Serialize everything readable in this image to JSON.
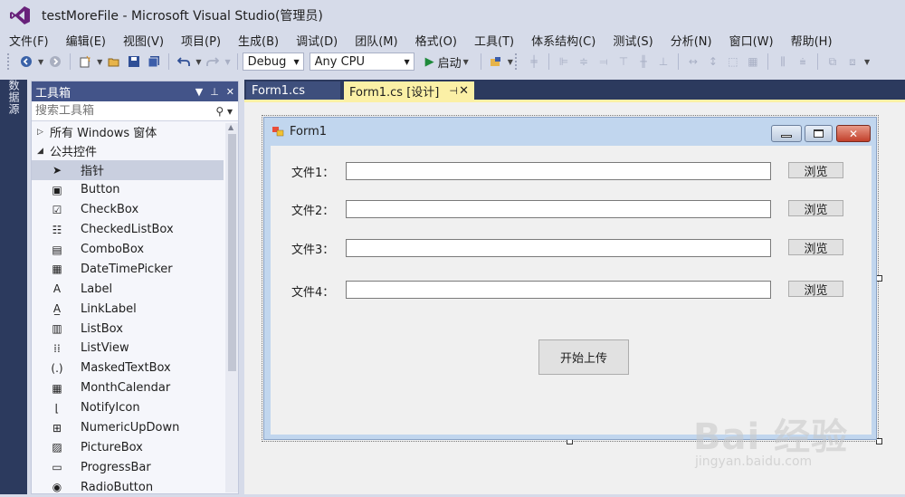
{
  "window": {
    "title": "testMoreFile - Microsoft Visual Studio(管理员)"
  },
  "menu": [
    "文件(F)",
    "编辑(E)",
    "视图(V)",
    "项目(P)",
    "生成(B)",
    "调试(D)",
    "团队(M)",
    "格式(O)",
    "工具(T)",
    "体系结构(C)",
    "测试(S)",
    "分析(N)",
    "窗口(W)",
    "帮助(H)"
  ],
  "toolbar": {
    "config": "Debug",
    "platform": "Any CPU",
    "start_label": "启动"
  },
  "left_strip": {
    "label": "数据源"
  },
  "toolbox": {
    "title": "工具箱",
    "search_placeholder": "搜索工具箱",
    "group_all": "所有 Windows 窗体",
    "group_common": "公共控件",
    "items": [
      "指针",
      "Button",
      "CheckBox",
      "CheckedListBox",
      "ComboBox",
      "DateTimePicker",
      "Label",
      "LinkLabel",
      "ListBox",
      "ListView",
      "MaskedTextBox",
      "MonthCalendar",
      "NotifyIcon",
      "NumericUpDown",
      "PictureBox",
      "ProgressBar",
      "RadioButton"
    ],
    "icons": [
      "pointer-icon",
      "button-icon",
      "checkbox-icon",
      "checkedlistbox-icon",
      "combobox-icon",
      "datetimepicker-icon",
      "label-icon",
      "linklabel-icon",
      "listbox-icon",
      "listview-icon",
      "maskedtextbox-icon",
      "monthcalendar-icon",
      "notifyicon-icon",
      "numericupdown-icon",
      "picturebox-icon",
      "progressbar-icon",
      "radiobutton-icon"
    ],
    "selected_index": 0
  },
  "tabs": [
    {
      "label": "Form1.cs",
      "active": false
    },
    {
      "label": "Form1.cs [设计]",
      "active": true
    }
  ],
  "form": {
    "title": "Form1",
    "rows": [
      {
        "label": "文件1：",
        "value": "",
        "button": "浏览"
      },
      {
        "label": "文件2：",
        "value": "",
        "button": "浏览"
      },
      {
        "label": "文件3：",
        "value": "",
        "button": "浏览"
      },
      {
        "label": "文件4：",
        "value": "",
        "button": "浏览"
      }
    ],
    "upload_button": "开始上传"
  },
  "watermark": {
    "main": "Bai 经验",
    "sub": "jingyan.baidu.com"
  },
  "colors": {
    "chrome": "#d6dbe9",
    "toolbox_header": "#435489",
    "active_tab": "#fbf0a6",
    "dark_panel": "#2c3a5e",
    "form_border": "#c1d6ee"
  }
}
